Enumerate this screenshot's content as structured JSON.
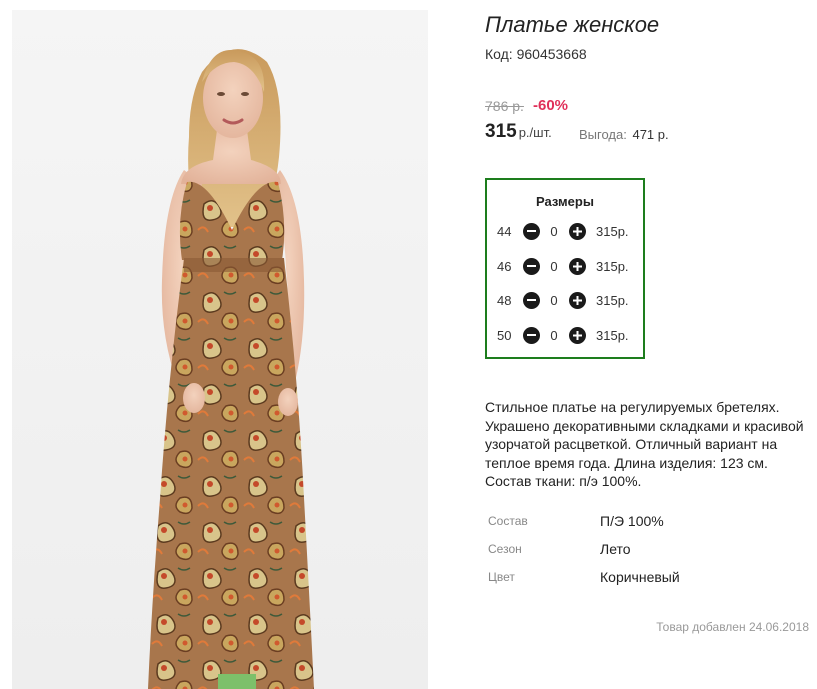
{
  "product": {
    "title": "Платье женское",
    "code_label": "Код:",
    "code": "960453668",
    "old_price": "786 р.",
    "discount": "-60%",
    "price": "315",
    "price_unit": "р./шт.",
    "saving_label": "Выгода:",
    "saving_value": "471 р.",
    "image_alt": "woman-in-paisley-maxi-dress"
  },
  "sizes": {
    "title": "Размеры",
    "rows": [
      {
        "size": "44",
        "qty": "0",
        "price": "315р."
      },
      {
        "size": "46",
        "qty": "0",
        "price": "315р."
      },
      {
        "size": "48",
        "qty": "0",
        "price": "315р."
      },
      {
        "size": "50",
        "qty": "0",
        "price": "315р."
      }
    ],
    "minus_icon": "minus-circle-icon",
    "plus_icon": "plus-circle-icon"
  },
  "description": "Стильное платье на регулируемых бретелях. Украшено декоративными складками и красивой узорчатой расцветкой. Отличный вариант на теплое время года. Длина изделия: 123 см. Состав ткани: п/э 100%.",
  "properties": [
    {
      "label": "Состав",
      "value": "П/Э 100%"
    },
    {
      "label": "Сезон",
      "value": "Лето"
    },
    {
      "label": "Цвет",
      "value": "Коричневый"
    }
  ],
  "added_date": "Товар добавлен 24.06.2018",
  "colors": {
    "accent_border": "#1d7d1d",
    "discount": "#e0305a",
    "muted": "#999999"
  }
}
